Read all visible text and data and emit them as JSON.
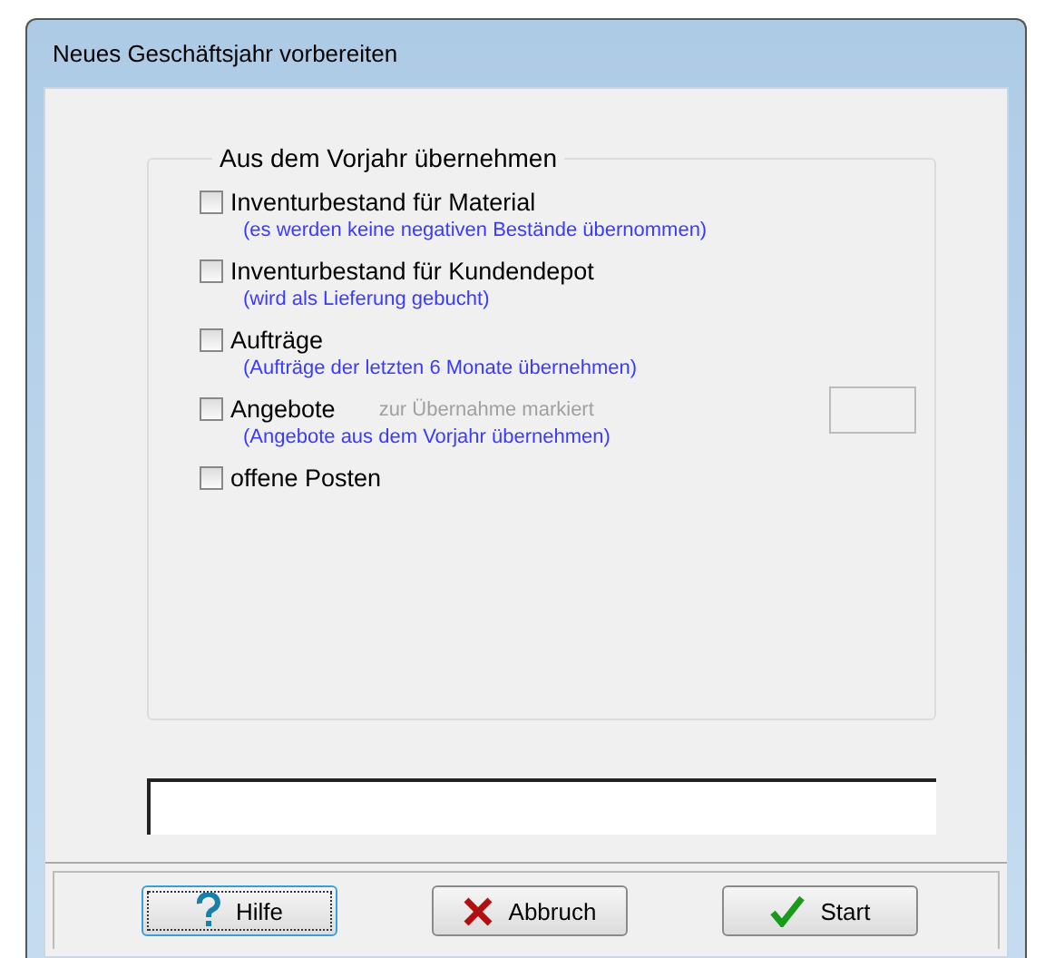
{
  "window": {
    "title": "Neues Geschäftsjahr vorbereiten"
  },
  "group": {
    "title": "Aus dem Vorjahr übernehmen",
    "options": [
      {
        "label": "Inventurbestand für Material",
        "hint": "(es werden keine negativen Bestände übernommen)",
        "checked": false
      },
      {
        "label": "Inventurbestand für Kundendepot",
        "hint": "(wird als Lieferung gebucht)",
        "checked": false
      },
      {
        "label": "Aufträge",
        "hint": "(Aufträge der letzten 6 Monate übernehmen)",
        "checked": false
      },
      {
        "label": "Angebote",
        "note": "zur Übernahme markiert",
        "hint": "(Angebote aus dem Vorjahr übernehmen)",
        "checked": false,
        "count_field": true
      },
      {
        "label": "offene Posten",
        "checked": false
      }
    ]
  },
  "buttons": [
    {
      "label": "Hilfe",
      "kind": "help",
      "focused": true
    },
    {
      "label": "Abbruch",
      "kind": "cancel",
      "focused": false
    },
    {
      "label": "Start",
      "kind": "start",
      "focused": false
    }
  ]
}
